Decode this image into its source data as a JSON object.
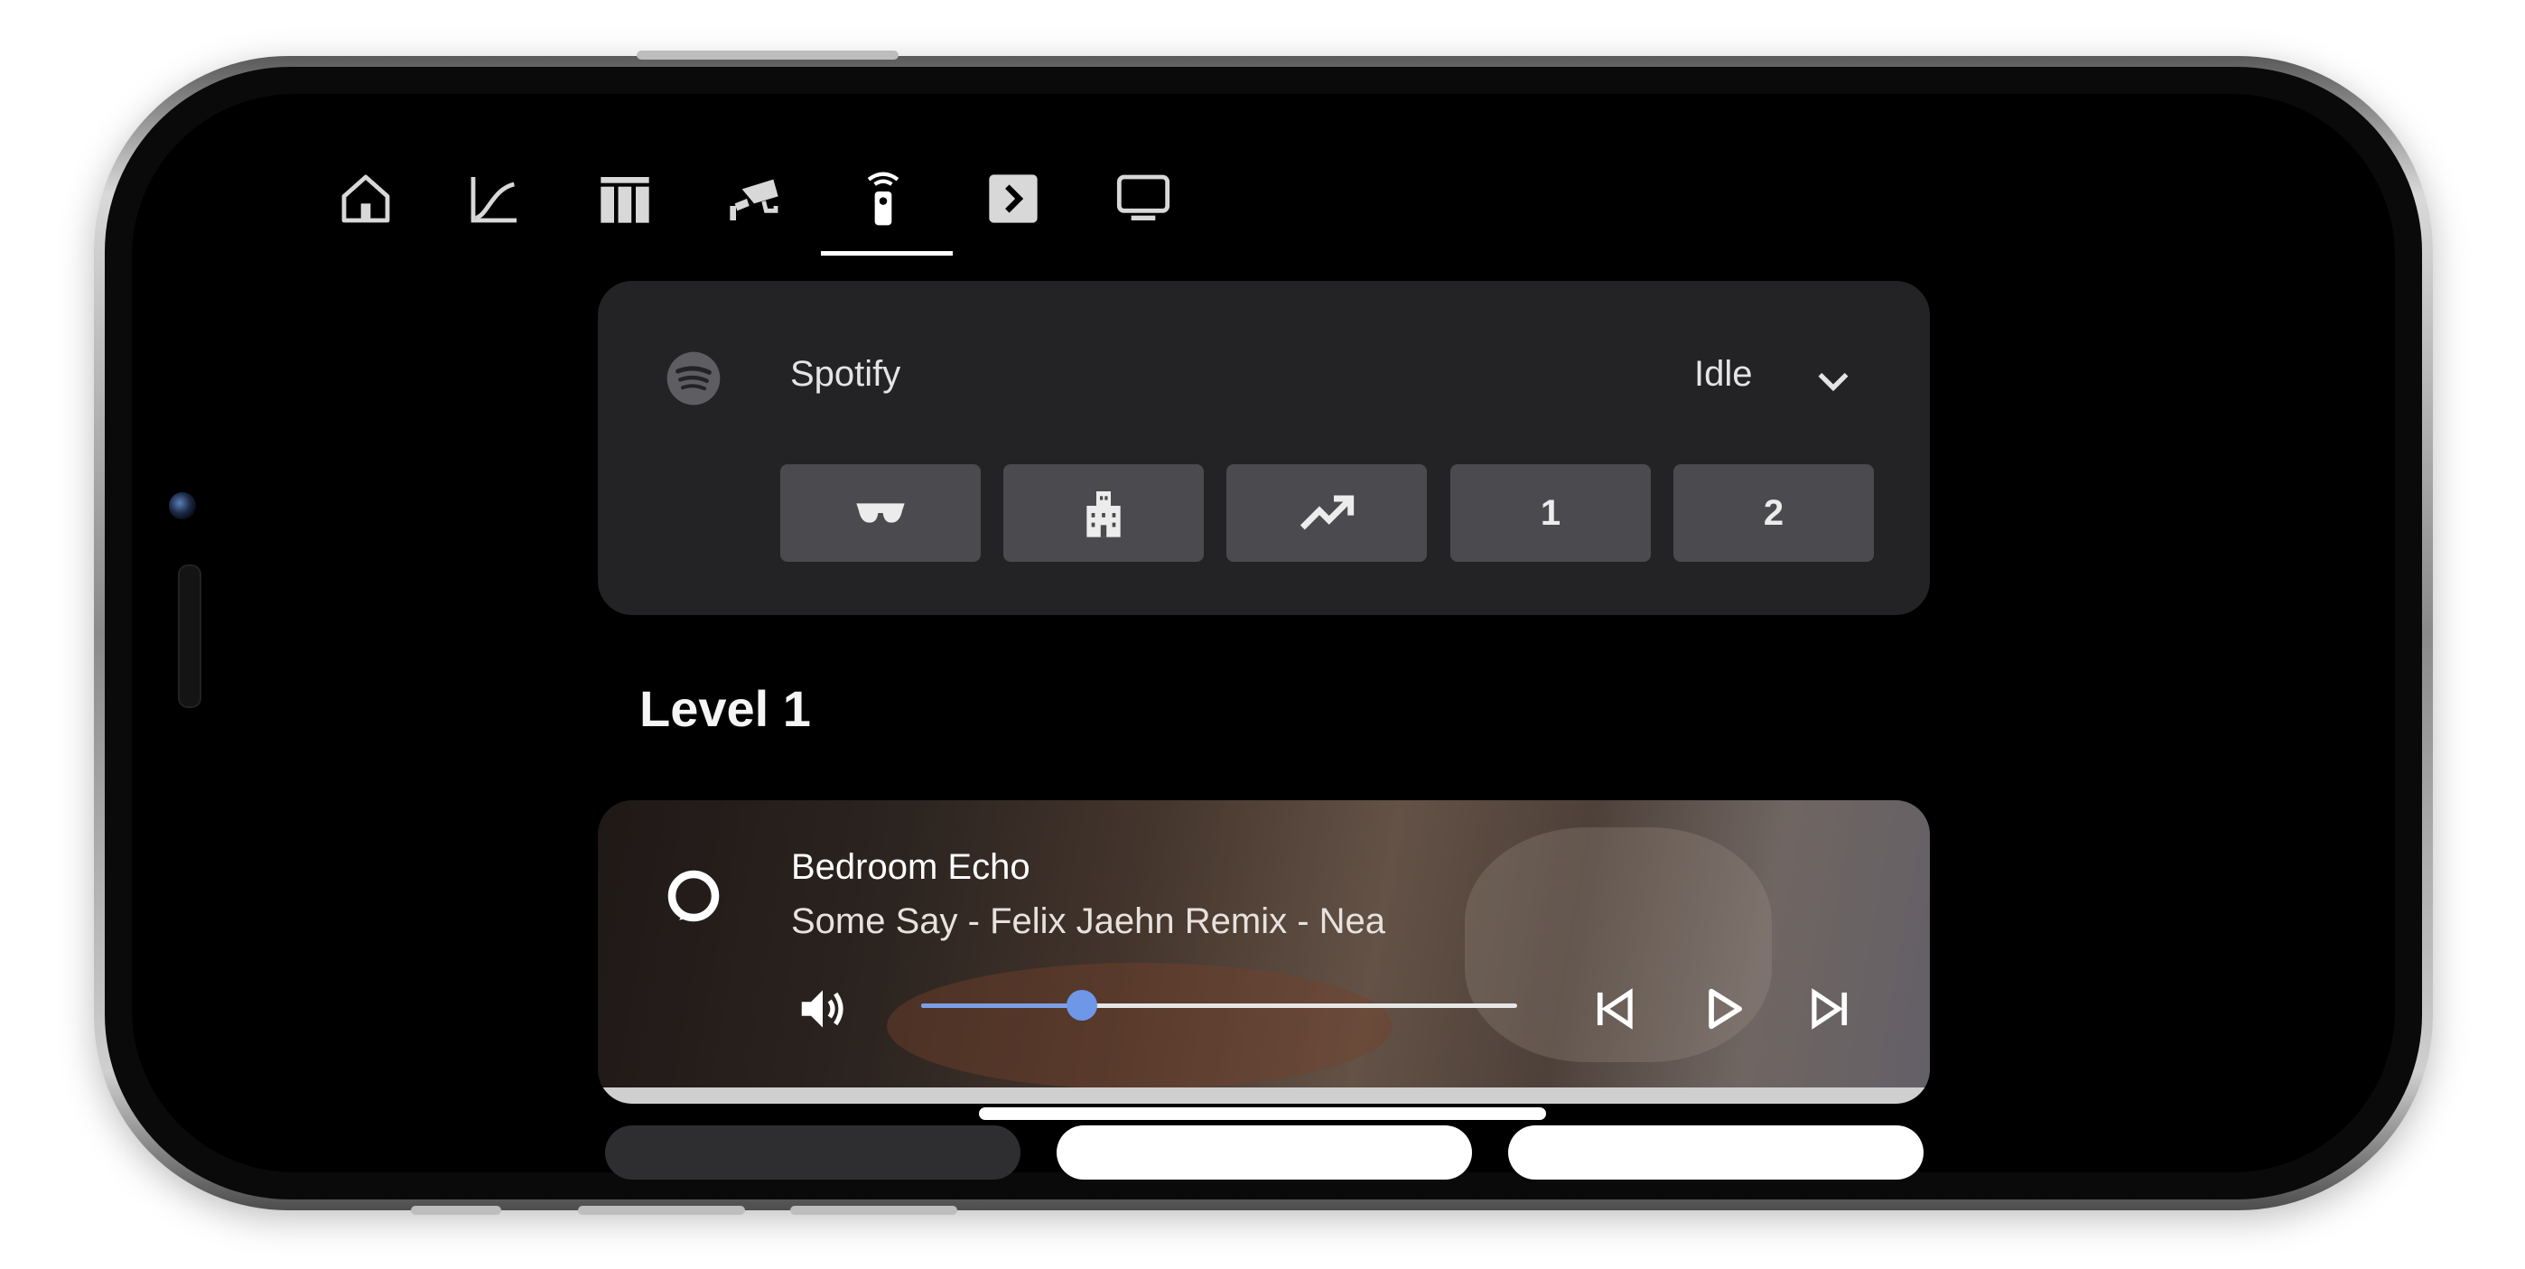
{
  "nav": {
    "tabs": [
      {
        "icon": "home-icon"
      },
      {
        "icon": "graph-icon"
      },
      {
        "icon": "columns-icon"
      },
      {
        "icon": "cctv-icon"
      },
      {
        "icon": "remote-icon",
        "active": true
      },
      {
        "icon": "terminal-icon"
      },
      {
        "icon": "monitor-icon"
      }
    ]
  },
  "media_control": {
    "source_icon": "spotify-icon",
    "source": "Spotify",
    "state": "Idle",
    "presets": [
      {
        "icon": "sunglasses-icon",
        "label": ""
      },
      {
        "icon": "office-building-icon",
        "label": ""
      },
      {
        "icon": "trending-up-icon",
        "label": ""
      },
      {
        "icon": "",
        "label": "1"
      },
      {
        "icon": "",
        "label": "2"
      }
    ]
  },
  "section": {
    "title": "Level 1"
  },
  "player": {
    "icon": "alexa-ring-icon",
    "device_name": "Bedroom Echo",
    "track": "Some Say - Felix Jaehn Remix - Nea",
    "volume_fraction": 0.27,
    "controls": [
      "volume-icon",
      "skip-previous-icon",
      "play-icon",
      "skip-next-icon"
    ]
  },
  "colors": {
    "accent": "#6e97e8",
    "card_bg": "#232326",
    "button_bg": "#4b4b4f",
    "text": "#e4e4e6"
  }
}
